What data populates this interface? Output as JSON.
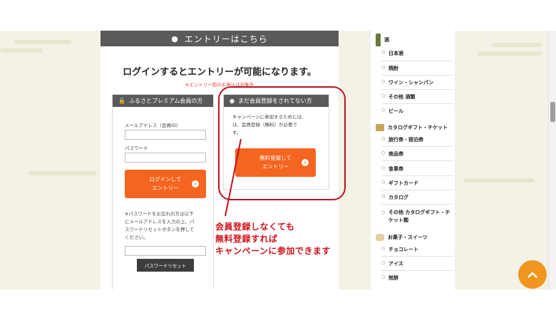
{
  "entry": {
    "header": "エントリーはこちら",
    "headline": "ログインするとエントリーが可能になります。",
    "note": "※エントリー前のお申込は対象外"
  },
  "login_box": {
    "title": "ふるさとプレミアム会員の方",
    "email_label": "メールアドレス（会員ID）",
    "password_label": "パスワード",
    "login_button_line1": "ログインして",
    "login_button_line2": "エントリー",
    "reset_note_lines": [
      "※パスワードをお忘れの方は以下",
      "にメールアドレスを入力の上、パ",
      "スワードリセットボタンを押して",
      "ください。"
    ],
    "reset_button": "パスワードリセット"
  },
  "signup_box": {
    "title": "まだ会員登録をされてない方",
    "desc_lines": [
      "キャンペーンに参加するためには、",
      "は、会員登録（無料）が必要で",
      "す。"
    ],
    "button_line1": "無料登録して",
    "button_line2": "エントリー"
  },
  "annotation": {
    "lines": [
      "会員登録しなくても",
      "無料登録すれば",
      "キャンペーンに参加できます"
    ],
    "color": "#c0111f"
  },
  "sidebar": {
    "categories": [
      {
        "icon": "sake-bottle-icon",
        "label": "酒",
        "items": [
          "日本酒",
          "焼酎",
          "ワイン・シャンパン",
          "その他 酒類",
          "ビール"
        ]
      },
      {
        "icon": "gift-ticket-icon",
        "label": "カタログギフト・チケット",
        "items": [
          "旅行券・宿泊券",
          "商品券",
          "食事券",
          "ギフトカード",
          "カタログ",
          "その他 カタログギフト・チケット類"
        ]
      },
      {
        "icon": "sweets-icon",
        "label": "お菓子・スイーツ",
        "items": [
          "チョコレート",
          "アイス",
          "煎餅"
        ]
      }
    ]
  },
  "scroll_top": {
    "icon": "chevron-up-icon",
    "color": "#f0961e"
  },
  "colors": {
    "accent": "#f4651f",
    "header_bg": "#5a5a5a",
    "note": "#e53935"
  }
}
